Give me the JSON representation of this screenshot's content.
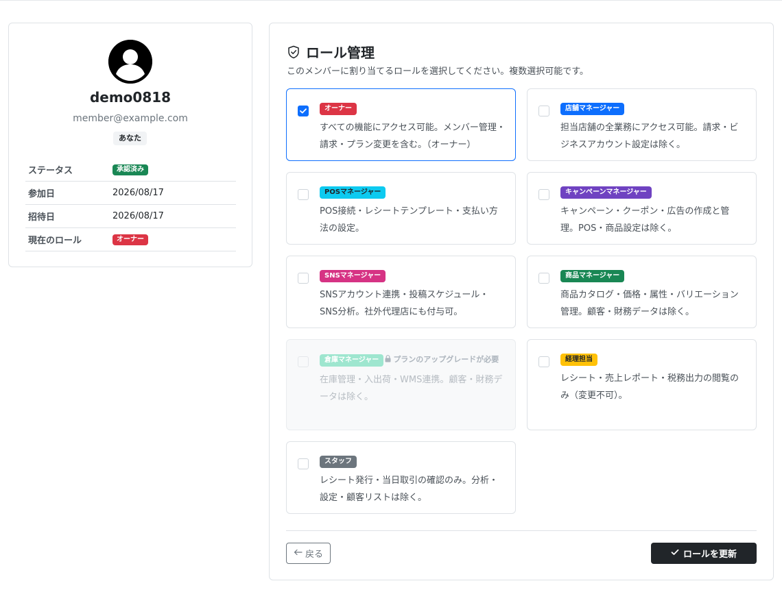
{
  "profile": {
    "username": "demo0818",
    "email": "member@example.com",
    "you_badge": "あなた",
    "rows": [
      {
        "key": "ステータス",
        "value": "承認済み",
        "pill_color": "#198754"
      },
      {
        "key": "参加日",
        "value": "2026/08/17"
      },
      {
        "key": "招待日",
        "value": "2026/08/17"
      },
      {
        "key": "現在のロール",
        "value": "オーナー",
        "pill_color": "#dc3545"
      }
    ]
  },
  "roles_panel": {
    "title": "ロール管理",
    "description": "このメンバーに割り当てるロールを選択してください。複数選択可能です。",
    "roles": [
      {
        "name": "オーナー",
        "color": "#dc3545",
        "desc": "すべての機能にアクセス可能。メンバー管理・請求・プラン変更を含む。（オーナー）",
        "checked": true,
        "disabled": false
      },
      {
        "name": "店舗マネージャー",
        "color": "#0d6efd",
        "desc": "担当店舗の全業務にアクセス可能。請求・ビジネスアカウント設定は除く。",
        "checked": false,
        "disabled": false
      },
      {
        "name": "POSマネージャー",
        "color": "#0dcaf0",
        "text_color": "#212529",
        "desc": "POS接続・レシートテンプレート・支払い方法の設定。",
        "checked": false,
        "disabled": false
      },
      {
        "name": "キャンペーンマネージャー",
        "color": "#6f42c1",
        "desc": "キャンペーン・クーポン・広告の作成と管理。POS・商品設定は除く。",
        "checked": false,
        "disabled": false
      },
      {
        "name": "SNSマネージャー",
        "color": "#d63384",
        "desc": "SNSアカウント連携・投稿スケジュール・SNS分析。社外代理店にも付与可。",
        "checked": false,
        "disabled": false
      },
      {
        "name": "商品マネージャー",
        "color": "#198754",
        "desc": "商品カタログ・価格・属性・バリエーション管理。顧客・財務データは除く。",
        "checked": false,
        "disabled": false
      },
      {
        "name": "倉庫マネージャー",
        "color": "#9ee6cf",
        "desc": "在庫管理・入出荷・WMS連携。顧客・財務データは除く。",
        "checked": false,
        "disabled": true,
        "lock_note": "プランのアップグレードが必要"
      },
      {
        "name": "経理担当",
        "color": "#ffc107",
        "text_color": "#212529",
        "desc": "レシート・売上レポート・税務出力の閲覧のみ（変更不可）。",
        "checked": false,
        "disabled": false
      },
      {
        "name": "スタッフ",
        "color": "#6c757d",
        "desc": "レシート発行・当日取引の確認のみ。分析・設定・顧客リストは除く。",
        "checked": false,
        "disabled": false
      }
    ],
    "back_label": "戻る",
    "update_label": "ロールを更新"
  }
}
